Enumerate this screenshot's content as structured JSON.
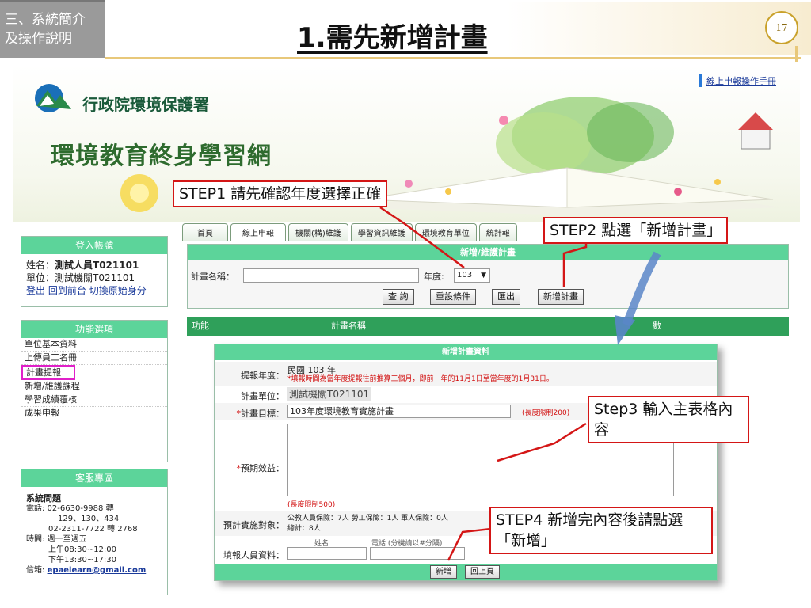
{
  "slide": {
    "section_line1": "三、系統簡介",
    "section_line2": "及操作說明",
    "title": "1.需先新增計畫",
    "page_number": "17"
  },
  "site": {
    "org_name": "行政院環境保護署",
    "site_name": "環境教育終身學習網",
    "manual_link": "線上申報操作手冊"
  },
  "nav": {
    "tabs": [
      "首頁",
      "線上申報",
      "機關(構)維護",
      "學習資訊維護",
      "環境教育單位",
      "統計報"
    ]
  },
  "login": {
    "header": "登入帳號",
    "name_label": "姓名：",
    "name_value": "測試人員T021101",
    "unit_label": "單位：",
    "unit_value": "測試機關T021101",
    "links": [
      "登出",
      "回到前台",
      "切換原始身分"
    ]
  },
  "functions": {
    "header": "功能選項",
    "items": [
      "單位基本資料",
      "上傳員工名冊",
      "計畫提報",
      "新增/維護課程",
      "學習成績覆核",
      "成果申報"
    ]
  },
  "service": {
    "header": "客服專區",
    "title": "系統問題",
    "lines": [
      "電話: 02-6630-9988 轉",
      "129、130、434",
      "02-2311-7722 轉 2768",
      "時間: 週一至週五",
      "上午08:30~12:00",
      "下午13:30~17:30",
      "信箱: "
    ],
    "email": "epaelearn@gmail.com"
  },
  "search": {
    "header": "新增/維護計畫",
    "plan_name_label": "計畫名稱：",
    "plan_name_value": "",
    "year_label": "年度:",
    "year_value": "103",
    "buttons": {
      "query": "查 詢",
      "reset": "重設條件",
      "export": "匯出",
      "add_plan": "新增計畫"
    }
  },
  "results": {
    "col_function": "功能",
    "col_plan_name": "計畫名稱",
    "col_count": "數"
  },
  "form": {
    "header": "新增計畫資料",
    "year_label": "提報年度：",
    "year_value": "民國 103 年",
    "year_note": "*填報時間為當年度提報往前推算三個月，即前一年的11月1日至當年度的1月31日。",
    "unit_label": "計畫單位：",
    "unit_value": "測試機關T021101",
    "goal_label": "計畫目標：",
    "goal_value": "103年度環境教育實施計畫",
    "goal_limit": "(長度限制200)",
    "benefit_label": "預期效益：",
    "benefit_limit": "(長度限制500)",
    "target_label": "預計實施對象：",
    "target_line1": "公教人員保險：7人   勞工保險：1人   軍人保險：0人",
    "target_line2": "總計：8人",
    "filler_label": "填報人員資料：",
    "filler_name_col": "姓名",
    "filler_phone_col": "電話 (分機請以#分隔)",
    "submit": "新增",
    "back": "回上頁"
  },
  "callouts": {
    "step1": "STEP1 請先確認年度選擇正確",
    "step2": "STEP2 點選「新增計畫」",
    "step3": "Step3 輸入主表格內容",
    "step4": "STEP4  新增完內容後請點選「新增」"
  },
  "colors": {
    "accent_green": "#5cd49a",
    "dark_green": "#2fa05a",
    "callout_red": "#d41616",
    "highlight_magenta": "#e020c8",
    "gold": "#e8c87a"
  }
}
